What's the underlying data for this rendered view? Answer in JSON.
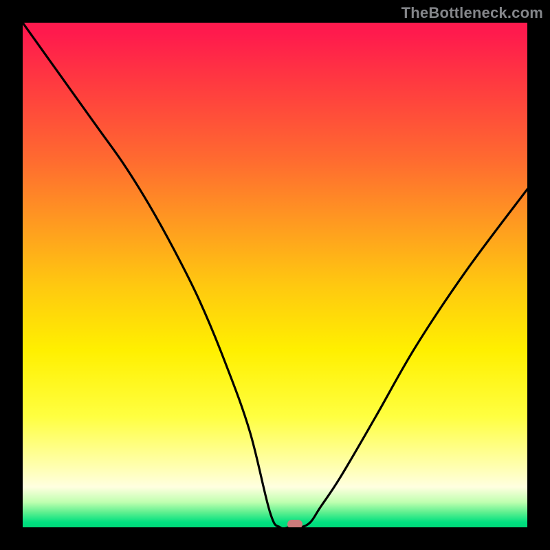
{
  "watermark": "TheBottleneck.com",
  "marker": {
    "x_pct": 54,
    "y_pct": 100
  },
  "chart_data": {
    "type": "line",
    "title": "",
    "xlabel": "",
    "ylabel": "",
    "xlim": [
      0,
      100
    ],
    "ylim": [
      0,
      100
    ],
    "grid": false,
    "legend": false,
    "background": "rainbow-gradient",
    "series": [
      {
        "name": "bottleneck-curve",
        "x": [
          0,
          5,
          10,
          15,
          20,
          25,
          30,
          35,
          40,
          45,
          49,
          51,
          53,
          55,
          57,
          59,
          63,
          70,
          78,
          88,
          100
        ],
        "y": [
          100,
          93,
          86,
          79,
          72,
          64,
          55,
          45,
          33,
          19,
          3,
          0,
          0,
          0,
          1,
          4,
          10,
          22,
          36,
          51,
          67
        ]
      }
    ],
    "annotations": [
      {
        "type": "marker",
        "x": 54,
        "y": 0,
        "color": "#cc7b7b",
        "shape": "rounded-rect"
      }
    ]
  },
  "colors": {
    "frame": "#000000",
    "curve": "#000000",
    "watermark": "#84868a",
    "marker": "#cc7b7b"
  }
}
